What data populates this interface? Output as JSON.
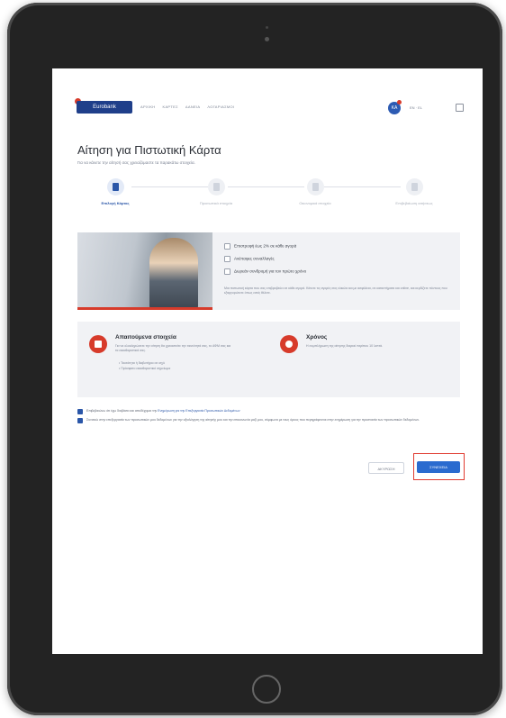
{
  "header": {
    "logo_text": "Eurobank",
    "nav_links": [
      "ΑΡΧΙΚΗ",
      "ΚΑΡΤΕΣ",
      "ΔΑΝΕΙΑ",
      "ΛΟΓΑΡΙΑΣΜΟΙ"
    ],
    "avatar_initials": "ΚΑ",
    "language": "EN · EL"
  },
  "page": {
    "title": "Αίτηση για Πιστωτική Κάρτα",
    "subtitle": "Για να κάνετε την αίτησή σας χρειαζόμαστε τα παρακάτω στοιχεία."
  },
  "steps": [
    {
      "label": "Επιλογή Κάρτας",
      "icon": "card-icon"
    },
    {
      "label": "Προσωπικά στοιχεία",
      "icon": "person-icon"
    },
    {
      "label": "Οικονομικά στοιχεία",
      "icon": "document-icon"
    },
    {
      "label": "Επιβεβαίωση αιτήσεως",
      "icon": "check-icon"
    }
  ],
  "offer": {
    "features": [
      "Επιστροφή έως 2% σε κάθε αγορά",
      "Ανέπαφες συναλλαγές",
      "Δωρεάν συνδρομή για τον πρώτο χρόνο"
    ],
    "description": "Μια πιστωτική κάρτα που σας επιβραβεύει σε κάθε αγορά. Κάνετε τις αγορές σας εύκολα και με ασφάλεια, σε καταστήματα και online, και κερδίζετε πόντους που εξαργυρώνετε όπως εσείς θέλετε."
  },
  "info_cards": [
    {
      "title": "Απαιτούμενα στοιχεία",
      "text": "Για να ολοκληρώσετε την αίτηση θα χρειαστείτε την ταυτότητά σας, το ΑΦΜ σας και τα εκκαθαριστικά σας.",
      "bullets": [
        "Ταυτότητα ή διαβατήριο σε ισχύ",
        "Πρόσφατο εκκαθαριστικό σημείωμα"
      ],
      "icon": "document-icon"
    },
    {
      "title": "Χρόνος",
      "text": "Η συμπλήρωση της αίτησης διαρκεί περίπου 10 λεπτά.",
      "icon": "clock-icon"
    }
  ],
  "consents": [
    {
      "text": "Επιβεβαιώνω ότι έχω διαβάσει και αποδέχομαι την ",
      "link": "Ενημέρωση για την Επεξεργασία Προσωπικών Δεδομένων"
    },
    {
      "text": "Συναινώ στην επεξεργασία των προσωπικών μου δεδομένων για την αξιολόγηση της αίτησής μου και την επικοινωνία μαζί μου, σύμφωνα με τους όρους που περιγράφονται στην ενημέρωση για την προστασία των προσωπικών δεδομένων.",
      "link": ""
    }
  ],
  "actions": {
    "back_label": "ΑΚΥΡΩΣΗ",
    "next_label": "ΣΥΝΕΧΕΙΑ"
  }
}
